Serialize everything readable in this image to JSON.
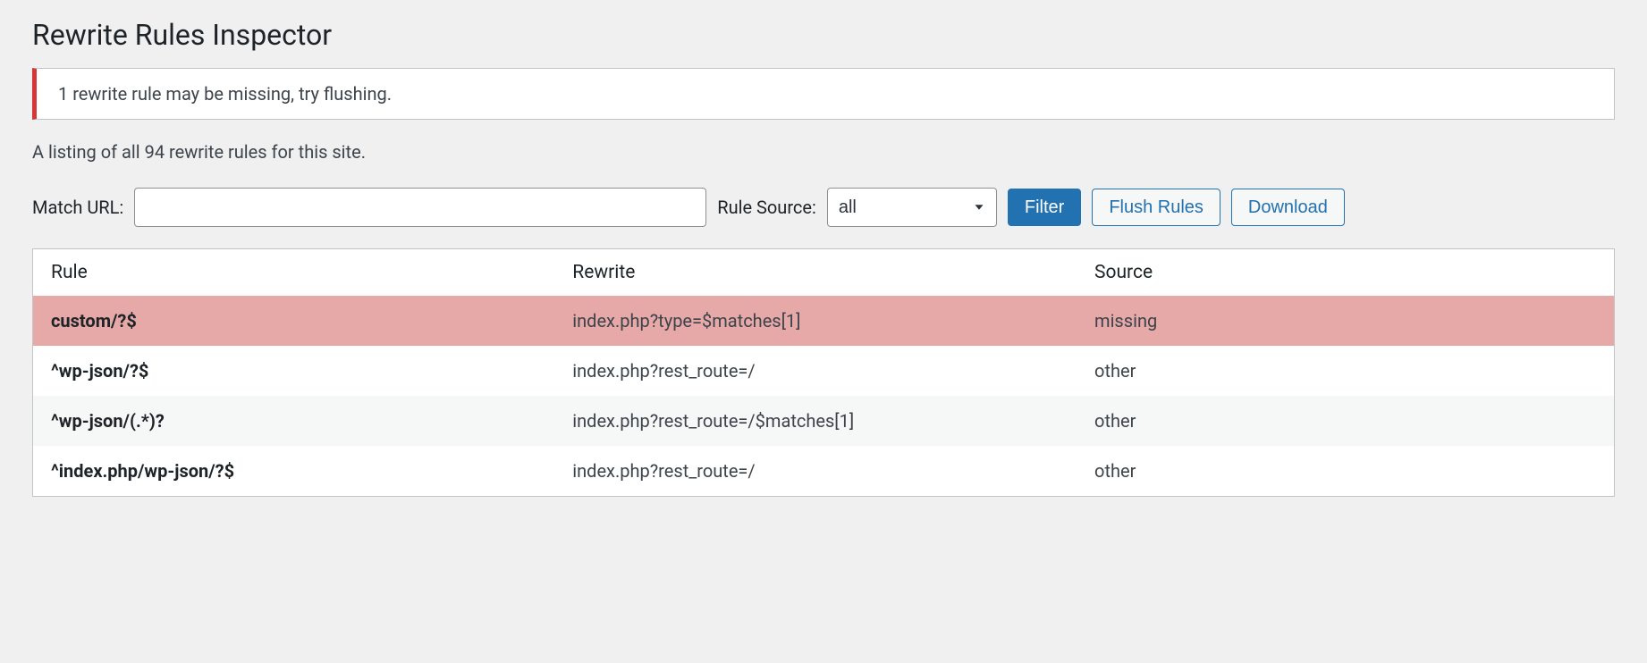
{
  "page": {
    "title": "Rewrite Rules Inspector"
  },
  "notice": {
    "message": "1 rewrite rule may be missing, try flushing."
  },
  "description": "A listing of all 94 rewrite rules for this site.",
  "controls": {
    "match_url_label": "Match URL:",
    "match_url_value": "",
    "rule_source_label": "Rule Source:",
    "rule_source_value": "all",
    "filter_label": "Filter",
    "flush_label": "Flush Rules",
    "download_label": "Download"
  },
  "table": {
    "headers": {
      "rule": "Rule",
      "rewrite": "Rewrite",
      "source": "Source"
    },
    "rows": [
      {
        "rule": "custom/?$",
        "rewrite": "index.php?type=$matches[1]",
        "source": "missing",
        "status": "missing"
      },
      {
        "rule": "^wp-json/?$",
        "rewrite": "index.php?rest_route=/",
        "source": "other",
        "status": "normal"
      },
      {
        "rule": "^wp-json/(.*)?",
        "rewrite": "index.php?rest_route=/$matches[1]",
        "source": "other",
        "status": "alt"
      },
      {
        "rule": "^index.php/wp-json/?$",
        "rewrite": "index.php?rest_route=/",
        "source": "other",
        "status": "normal"
      }
    ]
  }
}
